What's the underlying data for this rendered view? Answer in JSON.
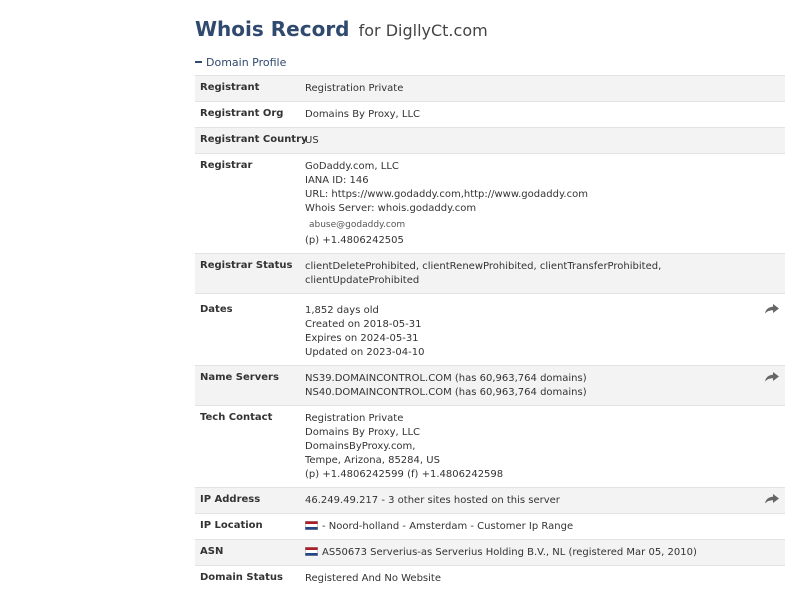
{
  "header": {
    "title": "Whois Record",
    "for_text": "for",
    "domain": "DigllyCt.com"
  },
  "section": {
    "label": "Domain Profile"
  },
  "rows": {
    "registrant": {
      "label": "Registrant",
      "value": "Registration Private"
    },
    "registrant_org": {
      "label": "Registrant Org",
      "value": "Domains By Proxy, LLC"
    },
    "registrant_country": {
      "label": "Registrant Country",
      "value": "US"
    },
    "registrar": {
      "label": "Registrar",
      "name": "GoDaddy.com, LLC",
      "iana": "IANA ID: 146",
      "url": "URL: https://www.godaddy.com,http://www.godaddy.com",
      "whois_server": "Whois Server: whois.godaddy.com",
      "email": "abuse@godaddy.com",
      "phone_prefix": "(p)",
      "phone": "+1.4806242505"
    },
    "registrar_status": {
      "label": "Registrar Status",
      "line1": "clientDeleteProhibited, clientRenewProhibited, clientTransferProhibited,",
      "line2": "clientUpdateProhibited"
    },
    "dates": {
      "label": "Dates",
      "age": "1,852 days old",
      "created": "Created on 2018-05-31",
      "expires": "Expires on 2024-05-31",
      "updated": "Updated on 2023-04-10"
    },
    "name_servers": {
      "label": "Name Servers",
      "ns1": "NS39.DOMAINCONTROL.COM (has 60,963,764 domains)",
      "ns2": "NS40.DOMAINCONTROL.COM (has 60,963,764 domains)"
    },
    "tech_contact": {
      "label": "Tech Contact",
      "line1": "Registration Private",
      "line2": "Domains By Proxy, LLC",
      "line3": "DomainsByProxy.com,",
      "line4": "Tempe, Arizona, 85284, US",
      "phone_prefix": "(p)",
      "phone": "+1.4806242599",
      "fax_prefix": "(f)",
      "fax": "+1.4806242598"
    },
    "ip_address": {
      "label": "IP Address",
      "value": "46.249.49.217 - 3 other sites hosted on this server"
    },
    "ip_location": {
      "label": "IP Location",
      "value": "- Noord-holland - Amsterdam - Customer Ip Range"
    },
    "asn": {
      "label": "ASN",
      "value": "AS50673 Serverius-as Serverius Holding B.V., NL (registered Mar 05, 2010)"
    },
    "domain_status": {
      "label": "Domain Status",
      "value": "Registered And No Website"
    }
  },
  "icons": {
    "share": "share-arrow-icon",
    "flag": "netherlands-flag-icon"
  },
  "colors": {
    "title": "#2f4a6e",
    "row_shade": "#f3f3f3",
    "divider": "#e3e3e3"
  }
}
